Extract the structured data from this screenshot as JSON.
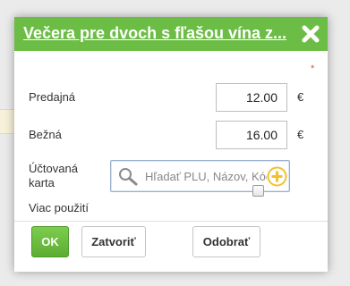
{
  "dialog": {
    "title": "Večera pre dvoch s fľašou vína z...",
    "close_icon": "close-x-icon"
  },
  "form": {
    "sale_price": {
      "label": "Predajná",
      "value": "12.00",
      "currency": "€",
      "required_mark": "*"
    },
    "regular_price": {
      "label": "Bežná",
      "value": "16.00",
      "currency": "€"
    },
    "account_card": {
      "label": "Účtovaná karta",
      "placeholder": "Hľadať PLU, Názov, Kód",
      "search_icon": "search-icon",
      "add_icon": "add-plus-icon"
    },
    "multi_use": {
      "label": "Viac použití",
      "checked": false
    }
  },
  "footer": {
    "ok_label": "OK",
    "close_label": "Zatvoriť",
    "remove_label": "Odobrať"
  },
  "colors": {
    "accent_green": "#6cbd45",
    "add_icon_yellow": "#f2c12e",
    "required_red": "#d9534f"
  }
}
